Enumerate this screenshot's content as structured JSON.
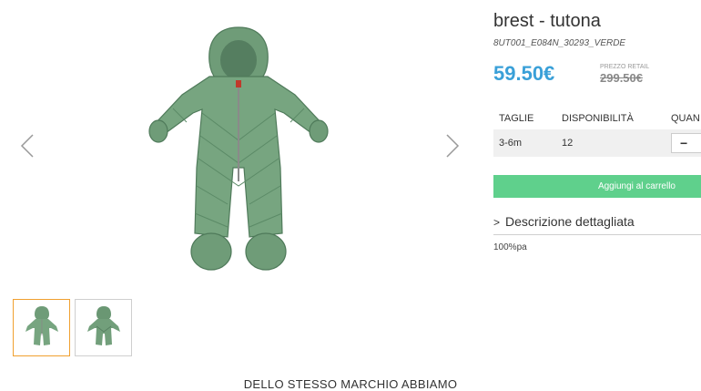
{
  "product": {
    "title": "brest - tutona",
    "sku": "8UT001_E084N_30293_VERDE",
    "price": "59.50€",
    "retail_label": "PREZZO RETAIL",
    "retail_price": "299.50€",
    "description_toggle": "Descrizione dettagliata",
    "description_text": "100%pa",
    "add_to_cart_label": "Aggiungi al carrello"
  },
  "sizes_table": {
    "headers": [
      "TAGLIE",
      "DISPONIBILITÀ",
      "QUAN"
    ],
    "rows": [
      {
        "size": "3-6m",
        "availability": "12",
        "qty_symbol": "−"
      }
    ]
  },
  "gallery": {
    "prev_icon": "chevron-left-icon",
    "next_icon": "chevron-right-icon",
    "thumbnails": [
      "front-view",
      "back-view"
    ]
  },
  "section_title": "DELLO STESSO MARCHIO ABBIAMO",
  "colors": {
    "price": "#3aa0d8",
    "add_to_cart": "#5fd08c",
    "thumb_active_border": "#f0a030",
    "garment_green": "#6f9c78"
  }
}
